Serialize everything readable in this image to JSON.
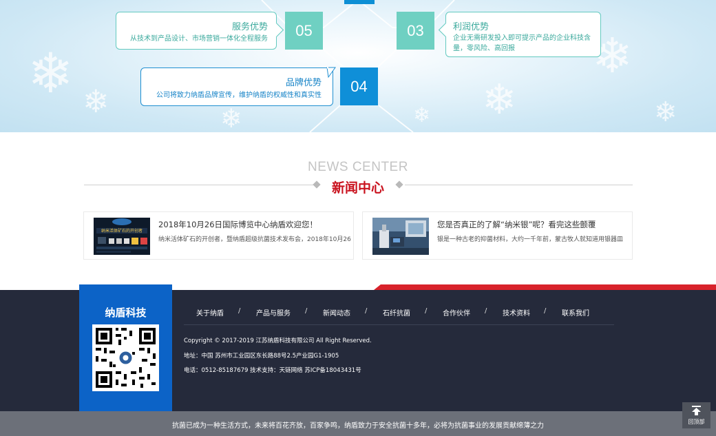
{
  "advantages": [
    {
      "num": "05",
      "title": "服务优势",
      "desc": "从技术到产品设计、市场营销一体化全程服务"
    },
    {
      "num": "03",
      "title": "利润优势",
      "desc": "企业无需研发投入即可提示产品的企业科技含量，零风险、高回报"
    },
    {
      "num": "04",
      "title": "品牌优势",
      "desc": "公司将致力纳盾品牌宣传，维护纳盾的权威性和真实性"
    }
  ],
  "news": {
    "title_en": "NEWS CENTER",
    "title_cn": "新闻中心",
    "items": [
      {
        "title": "2018年10月26日国际博览中心纳盾欢迎您！",
        "desc": "纳米活体矿石的开创者，暨纳盾超级抗菌技术发布会，2018年10月26",
        "thumb_text": "纳米活体矿石的开创者"
      },
      {
        "title": "您是否真正的了解“纳米银”呢？看完这些颤覆",
        "desc": "银是一种古老的抑菌材料，大约一千年前，蒙古牧人就知道用银器皿"
      }
    ]
  },
  "footer": {
    "brand": "纳盾科技",
    "nav": [
      "关于纳盾",
      "产品与服务",
      "新闻动态",
      "石纤抗菌",
      "合作伙伴",
      "技术资料",
      "联系我们"
    ],
    "separator": "/",
    "copyright": "Copyright © 2017-2019 江苏纳盾科技有限公司 All Right Reserved.",
    "address": "地址：中国 苏州市工业园区东长路88号2.5产业园G1-1905",
    "contact": "电话：0512-85187679 技术支持：天链网络 苏ICP备18043431号",
    "slogan": "抗菌已成为一种生活方式，未来将百花齐放，百家争鸣，纳盾致力于安全抗菌十多年，必将为抗菌事业的发展贡献绵薄之力",
    "back_to_top": "回顶部"
  },
  "colors": {
    "teal": "#6fd0c2",
    "blue": "#0f8fd8",
    "red": "#c9121e",
    "footer_bg": "#252a3b",
    "brand_blue": "#0c63c7"
  }
}
